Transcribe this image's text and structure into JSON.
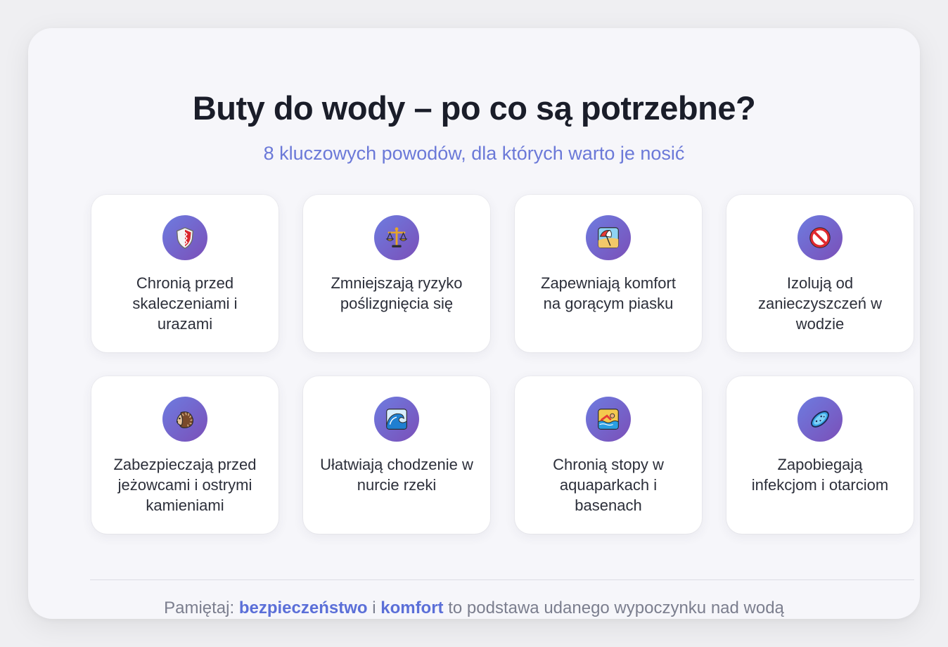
{
  "title": "Buty do wody – po co są potrzebne?",
  "subtitle": "8 kluczowych powodów, dla których warto je nosić",
  "items": [
    {
      "icon": "shield-icon",
      "label": "Chronią przed skaleczeniami i urazami"
    },
    {
      "icon": "balance-scale-icon",
      "label": "Zmniejszają ryzyko poślizgnięcia się"
    },
    {
      "icon": "beach-umbrella-icon",
      "label": "Zapewniają komfort na gorącym piasku"
    },
    {
      "icon": "prohibited-icon",
      "label": "Izolują od zanieczyszczeń w wodzie"
    },
    {
      "icon": "hedgehog-icon",
      "label": "Zabezpieczają przed jeżowcami i ostrymi kamieniami"
    },
    {
      "icon": "water-wave-icon",
      "label": "Ułatwiają chodzenie w nurcie rzeki"
    },
    {
      "icon": "swimmer-icon",
      "label": "Chronią stopy w aquaparkach i basenach"
    },
    {
      "icon": "microbe-icon",
      "label": "Zapobiegają infekcjom i otarciom"
    }
  ],
  "footer": {
    "prefix": "Pamiętaj:",
    "highlight1": "bezpieczeństwo",
    "connector": "i",
    "highlight2": "komfort",
    "suffix": "to podstawa udanego wypoczynku nad wodą"
  },
  "colors": {
    "accent": "#6b79d8",
    "icon_gradient_start": "#6d7ce0",
    "icon_gradient_end": "#7b4fb8",
    "title": "#1a1d29"
  }
}
